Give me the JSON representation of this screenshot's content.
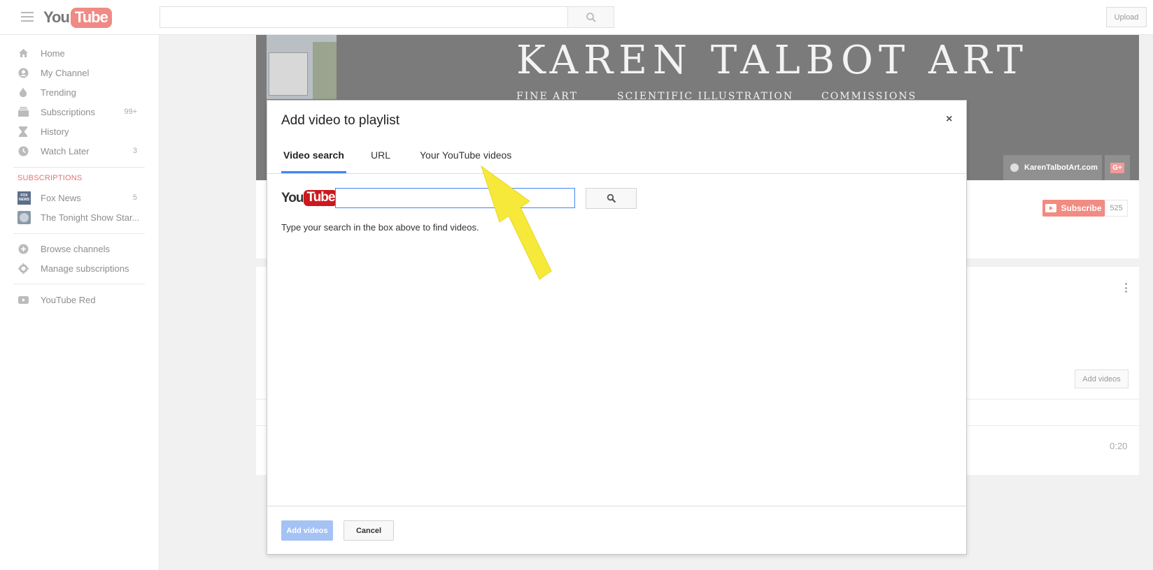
{
  "header": {
    "logo_you": "You",
    "logo_tube": "Tube",
    "upload_label": "Upload"
  },
  "sidebar": {
    "items": [
      {
        "label": "Home",
        "icon": "home-icon"
      },
      {
        "label": "My Channel",
        "icon": "account-icon"
      },
      {
        "label": "Trending",
        "icon": "flame-icon"
      },
      {
        "label": "Subscriptions",
        "icon": "subscriptions-icon",
        "count": "99+"
      },
      {
        "label": "History",
        "icon": "hourglass-icon"
      },
      {
        "label": "Watch Later",
        "icon": "clock-icon",
        "count": "3"
      }
    ],
    "subscriptions_title": "SUBSCRIPTIONS",
    "subscriptions": [
      {
        "label": "Fox News",
        "count": "5",
        "thumb": "FOX NEWS"
      },
      {
        "label": "The Tonight Show Star..."
      }
    ],
    "extra_items": [
      {
        "label": "Browse channels",
        "icon": "plus-circle-icon"
      },
      {
        "label": "Manage subscriptions",
        "icon": "gear-icon"
      }
    ],
    "red_item": {
      "label": "YouTube Red",
      "icon": "youtube-red-icon"
    }
  },
  "channel": {
    "banner_title": "KAREN TALBOT ART",
    "banner_subtitles": [
      "FINE ART",
      "SCIENTIFIC ILLUSTRATION",
      "COMMISSIONS"
    ],
    "website_link": "KarenTalbotArt.com",
    "gplus_label": "G+",
    "subscribe_label": "Subscribe",
    "subscriber_count": "525",
    "add_videos_label": "Add videos",
    "video_duration": "0:20"
  },
  "dialog": {
    "title": "Add video to playlist",
    "close_label": "×",
    "tabs": [
      {
        "label": "Video search",
        "active": true
      },
      {
        "label": "URL",
        "active": false
      },
      {
        "label": "Your YouTube videos",
        "active": false
      }
    ],
    "logo_you": "You",
    "logo_tube": "Tube",
    "search_value": "",
    "search_hint": "Type your search in the box above to find videos.",
    "add_videos_label": "Add videos",
    "cancel_label": "Cancel"
  },
  "colors": {
    "accent_blue": "#4285f4",
    "annotation_arrow": "#f7e93a",
    "youtube_red": "#cc181e"
  }
}
